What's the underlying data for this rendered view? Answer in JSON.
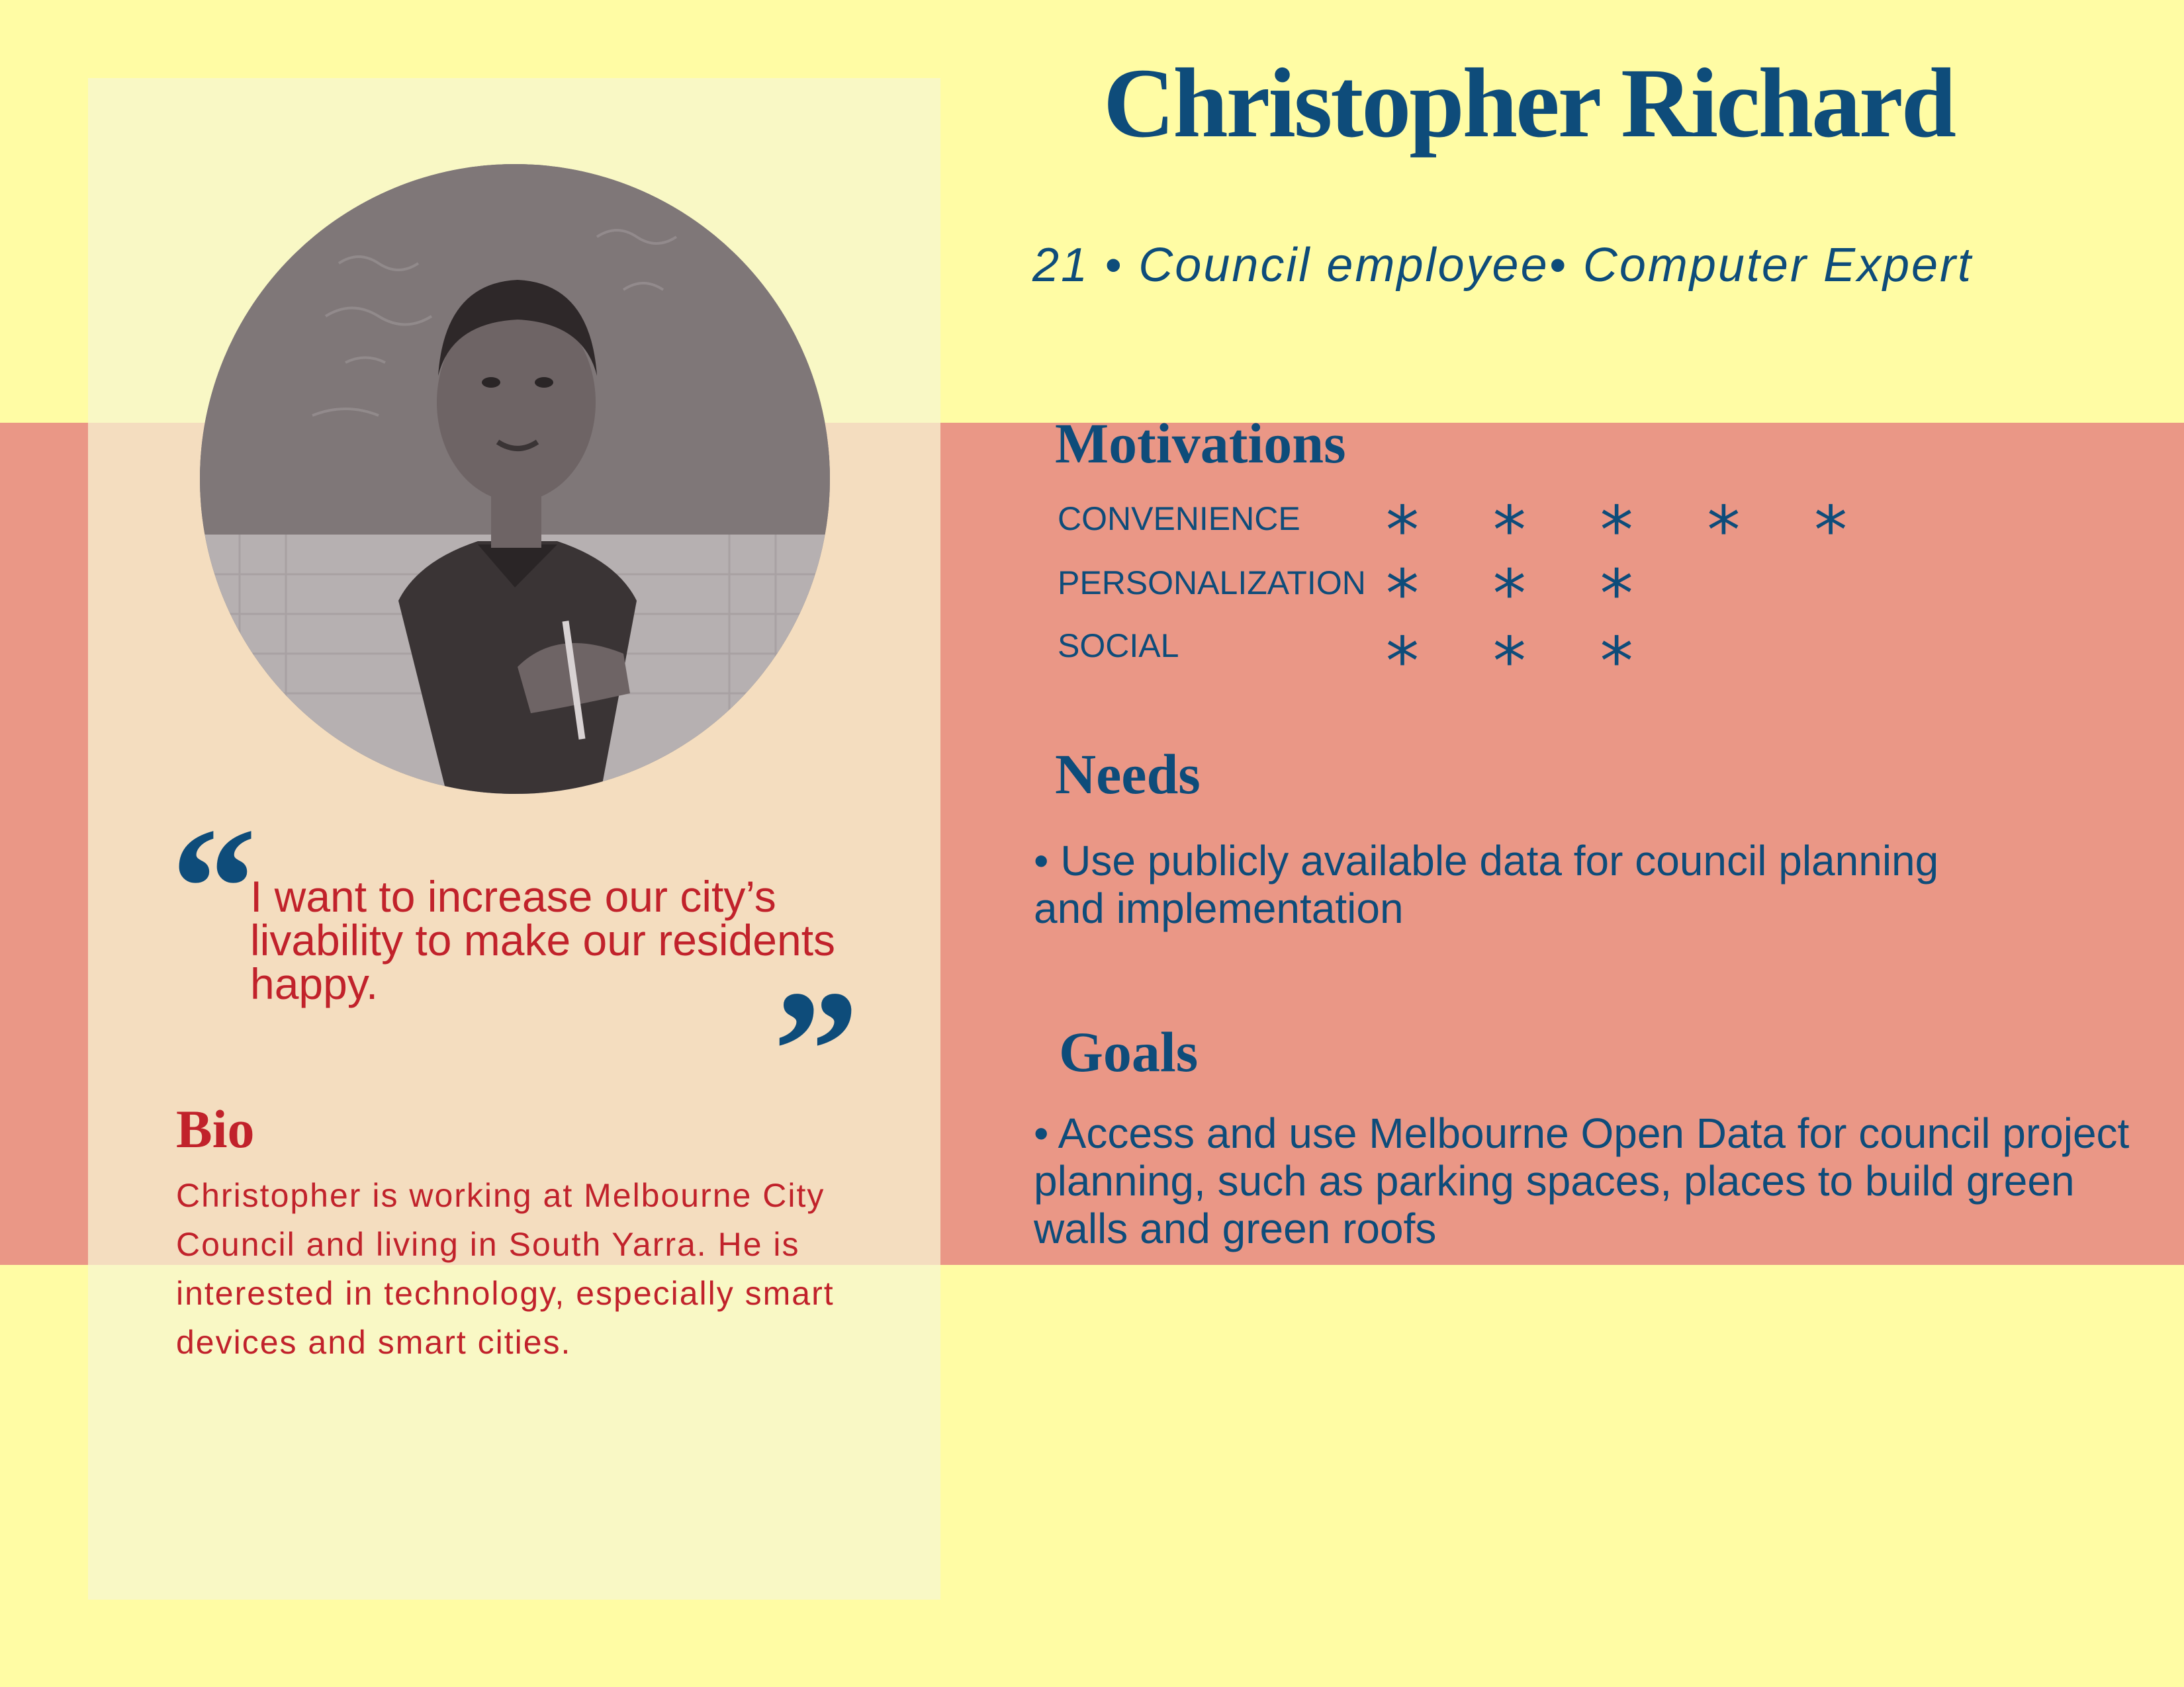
{
  "persona": {
    "name": "Christopher Richard",
    "subtitle": "21 • Council employee• Computer Expert"
  },
  "photo": {
    "alt": "Portrait of a young man holding a pen in front of a chalkboard"
  },
  "quote": {
    "open_mark": "“",
    "text": "I want to increase our city’s livability to make our residents happy.",
    "close_mark": "”"
  },
  "bio": {
    "title": "Bio",
    "text": "Christopher is working at Melbourne City Council and living in South Yarra. He is interested in technology, especially smart devices and smart cities."
  },
  "motivations": {
    "title": "Motivations",
    "items": [
      {
        "label": "CONVENIENCE",
        "rating": 5,
        "stars": "* * * * *"
      },
      {
        "label": "PERSONALIZATION",
        "rating": 3,
        "stars": "* * *"
      },
      {
        "label": "SOCIAL",
        "rating": 3,
        "stars": "* * *"
      }
    ]
  },
  "needs": {
    "title": "Needs",
    "text": "• Use publicly available data for council planning and implementation"
  },
  "goals": {
    "title": "Goals",
    "text": "• Access and use Melbourne Open Data for council project planning, such as parking spaces, places to build green walls and green roofs"
  },
  "colors": {
    "background_yellow": "#FFFCA4",
    "band_salmon": "#EA9786",
    "card_light": "#F9F8C5",
    "card_peach": "#F4DDBF",
    "navy": "#0E4C7A",
    "red": "#C1222B"
  }
}
